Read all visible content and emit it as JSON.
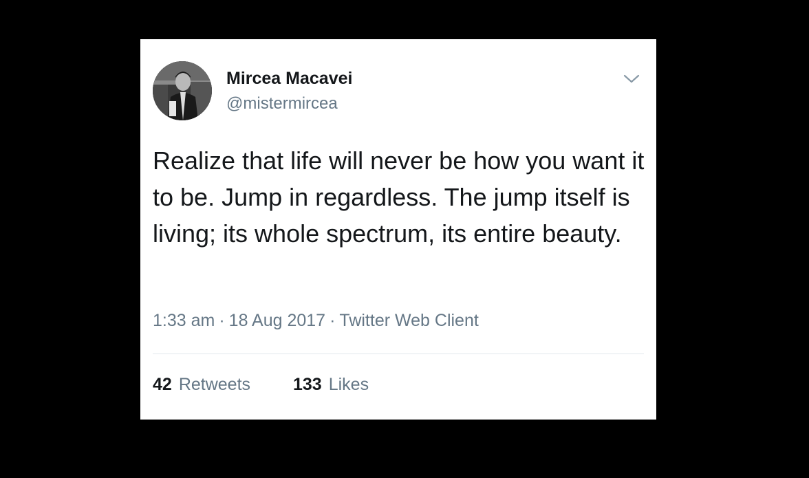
{
  "user": {
    "name": "Mircea Macavei",
    "handle": "@mistermircea"
  },
  "tweet": {
    "text": "Realize that life will never be how you want it to be. Jump in regardless. The jump itself is living; its whole spectrum, its entire beauty.",
    "time": "1:33 am",
    "date": "18 Aug 2017",
    "source": "Twitter Web Client",
    "separator": "·"
  },
  "stats": {
    "retweets_count": "42",
    "retweets_label": "Retweets",
    "likes_count": "133",
    "likes_label": "Likes"
  },
  "icons": {
    "menu": "chevron-down-icon"
  },
  "colors": {
    "background": "#000000",
    "card": "#ffffff",
    "text_primary": "#14171a",
    "text_secondary": "#657786",
    "divider": "#e1e8ed"
  }
}
